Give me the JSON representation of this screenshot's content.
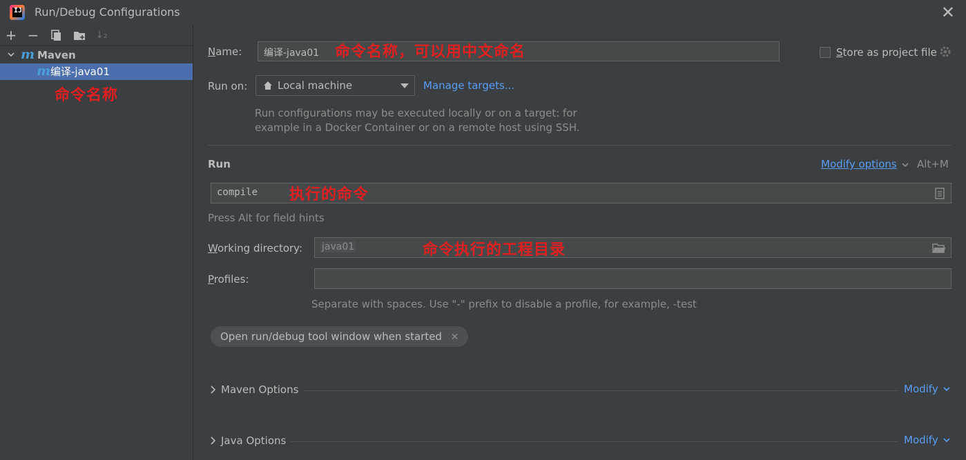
{
  "window": {
    "title": "Run/Debug Configurations"
  },
  "tree": {
    "group_label": "Maven",
    "item_label": "编译-java01",
    "annotation": "命令名称"
  },
  "form": {
    "name_label_u": "N",
    "name_label_rest": "ame:",
    "name_value": "编译-java01",
    "name_annotation": "命令名称，可以用中文命名",
    "store_u": "S",
    "store_rest": "tore as project file",
    "run_on_label": "Run on:",
    "run_on_value": "Local machine",
    "manage_targets": "Manage targets...",
    "run_on_hint_1": "Run configurations may be executed locally or on a target: for",
    "run_on_hint_2": "example in a Docker Container or on a remote host using SSH.",
    "run_section": "Run",
    "modify_options": "Modify options",
    "modify_shortcut": "Alt+M",
    "command_value": "compile",
    "command_annotation": "执行的命令",
    "field_hints": "Press Alt for field hints",
    "working_dir_u": "W",
    "working_dir_rest": "orking directory:",
    "working_dir_value": "java01",
    "working_dir_annotation": "命令执行的工程目录",
    "profiles_u": "P",
    "profiles_rest": "rofiles:",
    "profiles_value": "",
    "profiles_hint": "Separate with spaces. Use \"-\" prefix to disable a profile, for example, -test",
    "chip_label": "Open run/debug tool window when started",
    "maven_options": "Maven Options",
    "java_options": "Java Options",
    "modify": "Modify"
  },
  "colors": {
    "accent_link": "#589df6",
    "selection": "#4b6eaf",
    "annotation": "#e02020"
  }
}
